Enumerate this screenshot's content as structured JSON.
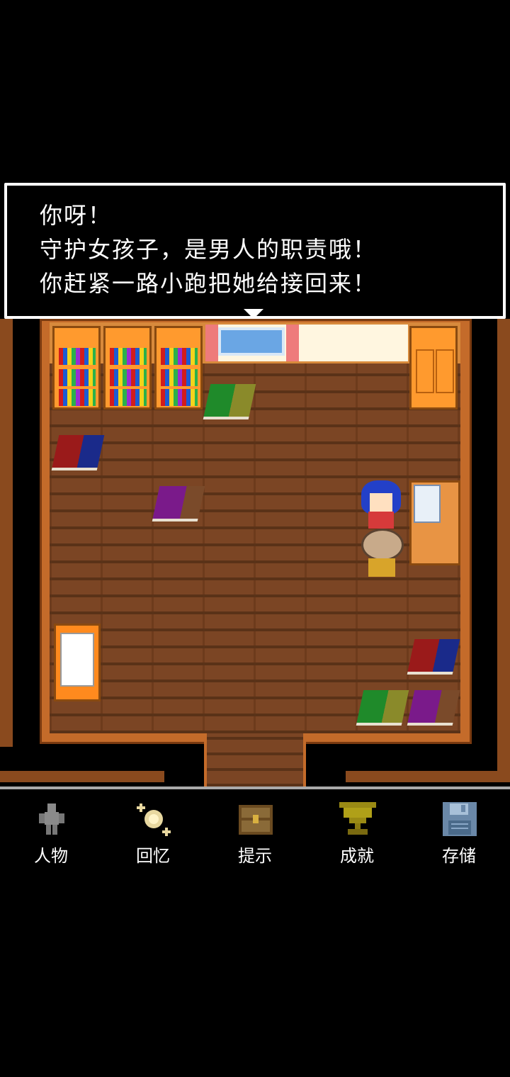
{
  "dialog": {
    "lines": [
      "你呀！",
      "守护女孩子，是男人的职责哦！",
      "你赶紧一路小跑把她给接回来！"
    ]
  },
  "menu": {
    "items": [
      {
        "label": "人物",
        "icon": "person-icon"
      },
      {
        "label": "回忆",
        "icon": "sparkle-orb-icon"
      },
      {
        "label": "提示",
        "icon": "treasure-chest-icon"
      },
      {
        "label": "成就",
        "icon": "trophy-icon"
      },
      {
        "label": "存储",
        "icon": "floppy-disk-icon"
      }
    ]
  },
  "colors": {
    "floor": "#7b4524",
    "wall": "#c46b2a",
    "menu_text": "#ffffff",
    "dialog_bg": "#000000",
    "dialog_border": "#ffffff"
  }
}
